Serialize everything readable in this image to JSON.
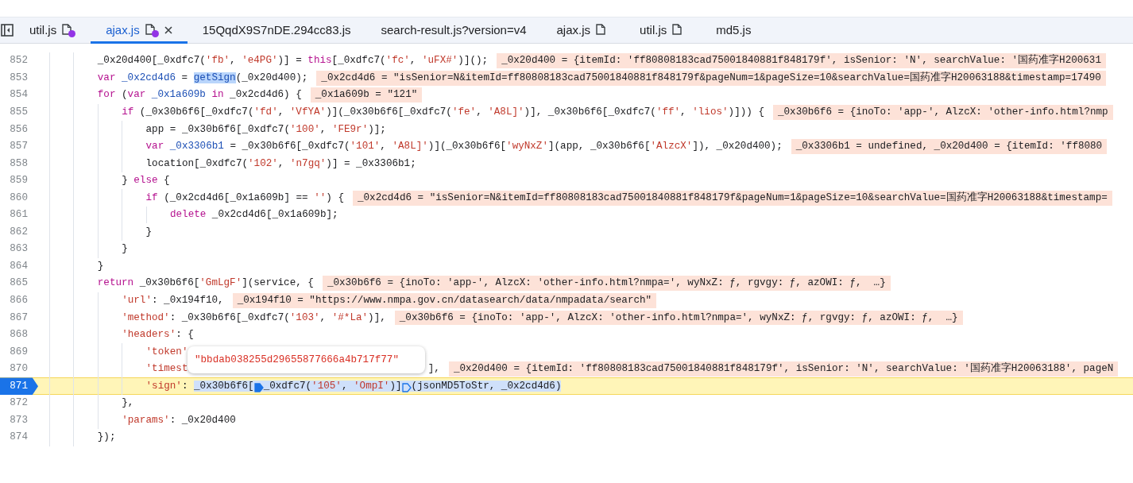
{
  "tabs": [
    {
      "label": "util.js",
      "selected": false,
      "file_icon": true,
      "dot": true,
      "closable": false
    },
    {
      "label": "ajax.js",
      "selected": true,
      "file_icon": true,
      "dot": true,
      "closable": true
    },
    {
      "label": "15QqdX9S7nDE.294cc83.js",
      "selected": false,
      "file_icon": false,
      "dot": false,
      "closable": false
    },
    {
      "label": "search-result.js?version=v4",
      "selected": false,
      "file_icon": false,
      "dot": false,
      "closable": false
    },
    {
      "label": "ajax.js",
      "selected": false,
      "file_icon": true,
      "dot": false,
      "closable": false
    },
    {
      "label": "util.js",
      "selected": false,
      "file_icon": true,
      "dot": false,
      "closable": false
    },
    {
      "label": "md5.js",
      "selected": false,
      "file_icon": false,
      "dot": false,
      "closable": false
    }
  ],
  "lines": [
    {
      "number": "852",
      "paused": false,
      "tokens": [
        {
          "kind": "plain",
          "text": "        _0x20d400[_0xdfc7("
        },
        {
          "kind": "string",
          "text": "'fb'"
        },
        {
          "kind": "plain",
          "text": ", "
        },
        {
          "kind": "string",
          "text": "'e4PG'"
        },
        {
          "kind": "plain",
          "text": ")] = "
        },
        {
          "kind": "keyword",
          "text": "this"
        },
        {
          "kind": "plain",
          "text": "[_0xdfc7("
        },
        {
          "kind": "string",
          "text": "'fc'"
        },
        {
          "kind": "plain",
          "text": ", "
        },
        {
          "kind": "string",
          "text": "'uFX#'"
        },
        {
          "kind": "plain",
          "text": ")]();"
        }
      ],
      "inline_value": "_0x20d400 = {itemId: 'ff80808183cad75001840881f848179f', isSenior: 'N', searchValue: '国药准字H200631"
    },
    {
      "number": "853",
      "paused": false,
      "tokens": [
        {
          "kind": "keyword",
          "text": "        var"
        },
        {
          "kind": "def",
          "text": " _0x2cd4d6"
        },
        {
          "kind": "plain",
          "text": " = "
        },
        {
          "kind": "match",
          "text": "getSign"
        },
        {
          "kind": "plain",
          "text": "(_0x20d400);"
        }
      ],
      "inline_value": "_0x2cd4d6 = \"isSenior=N&itemId=ff80808183cad75001840881f848179f&pageNum=1&pageSize=10&searchValue=国药准字H20063188&timestamp=17490"
    },
    {
      "number": "854",
      "paused": false,
      "tokens": [
        {
          "kind": "keyword",
          "text": "        for"
        },
        {
          "kind": "plain",
          "text": " ("
        },
        {
          "kind": "keyword",
          "text": "var"
        },
        {
          "kind": "def",
          "text": " _0x1a609b"
        },
        {
          "kind": "keyword",
          "text": " in"
        },
        {
          "kind": "plain",
          "text": " _0x2cd4d6) {"
        }
      ],
      "inline_value": "_0x1a609b = \"121\""
    },
    {
      "number": "855",
      "paused": false,
      "tokens": [
        {
          "kind": "keyword",
          "text": "            if"
        },
        {
          "kind": "plain",
          "text": " (_0x30b6f6[_0xdfc7("
        },
        {
          "kind": "string",
          "text": "'fd'"
        },
        {
          "kind": "plain",
          "text": ", "
        },
        {
          "kind": "string",
          "text": "'VfYA'"
        },
        {
          "kind": "plain",
          "text": ")](_0x30b6f6[_0xdfc7("
        },
        {
          "kind": "string",
          "text": "'fe'"
        },
        {
          "kind": "plain",
          "text": ", "
        },
        {
          "kind": "string",
          "text": "'A8L]'"
        },
        {
          "kind": "plain",
          "text": ")], _0x30b6f6[_0xdfc7("
        },
        {
          "kind": "string",
          "text": "'ff'"
        },
        {
          "kind": "plain",
          "text": ", "
        },
        {
          "kind": "string",
          "text": "'lios'"
        },
        {
          "kind": "plain",
          "text": ")])) {"
        }
      ],
      "inline_value": "_0x30b6f6 = {inoTo: 'app-', AlzcX: 'other-info.html?nmp"
    },
    {
      "number": "856",
      "paused": false,
      "tokens": [
        {
          "kind": "plain",
          "text": "                app = _0x30b6f6[_0xdfc7("
        },
        {
          "kind": "string",
          "text": "'100'"
        },
        {
          "kind": "plain",
          "text": ", "
        },
        {
          "kind": "string",
          "text": "'FE9r'"
        },
        {
          "kind": "plain",
          "text": ")];"
        }
      ]
    },
    {
      "number": "857",
      "paused": false,
      "tokens": [
        {
          "kind": "keyword",
          "text": "                var"
        },
        {
          "kind": "def",
          "text": " _0x3306b1"
        },
        {
          "kind": "plain",
          "text": " = _0x30b6f6[_0xdfc7("
        },
        {
          "kind": "string",
          "text": "'101'"
        },
        {
          "kind": "plain",
          "text": ", "
        },
        {
          "kind": "string",
          "text": "'A8L]'"
        },
        {
          "kind": "plain",
          "text": ")](_0x30b6f6["
        },
        {
          "kind": "string",
          "text": "'wyNxZ'"
        },
        {
          "kind": "plain",
          "text": "](app, _0x30b6f6["
        },
        {
          "kind": "string",
          "text": "'AlzcX'"
        },
        {
          "kind": "plain",
          "text": "]), _0x20d400);"
        }
      ],
      "inline_value": "_0x3306b1 = undefined, _0x20d400 = {itemId: 'ff8080"
    },
    {
      "number": "858",
      "paused": false,
      "tokens": [
        {
          "kind": "plain",
          "text": "                location[_0xdfc7("
        },
        {
          "kind": "string",
          "text": "'102'"
        },
        {
          "kind": "plain",
          "text": ", "
        },
        {
          "kind": "string",
          "text": "'n7gq'"
        },
        {
          "kind": "plain",
          "text": ")] = _0x3306b1;"
        }
      ]
    },
    {
      "number": "859",
      "paused": false,
      "tokens": [
        {
          "kind": "plain",
          "text": "            } "
        },
        {
          "kind": "keyword",
          "text": "else"
        },
        {
          "kind": "plain",
          "text": " {"
        }
      ]
    },
    {
      "number": "860",
      "paused": false,
      "tokens": [
        {
          "kind": "keyword",
          "text": "                if"
        },
        {
          "kind": "plain",
          "text": " (_0x2cd4d6[_0x1a609b] == "
        },
        {
          "kind": "string",
          "text": "''"
        },
        {
          "kind": "plain",
          "text": ") {"
        }
      ],
      "inline_value": "_0x2cd4d6 = \"isSenior=N&itemId=ff80808183cad75001840881f848179f&pageNum=1&pageSize=10&searchValue=国药准字H20063188&timestamp="
    },
    {
      "number": "861",
      "paused": false,
      "tokens": [
        {
          "kind": "keyword",
          "text": "                    delete"
        },
        {
          "kind": "plain",
          "text": " _0x2cd4d6[_0x1a609b];"
        }
      ]
    },
    {
      "number": "862",
      "paused": false,
      "tokens": [
        {
          "kind": "plain",
          "text": "                }"
        }
      ]
    },
    {
      "number": "863",
      "paused": false,
      "tokens": [
        {
          "kind": "plain",
          "text": "            }"
        }
      ]
    },
    {
      "number": "864",
      "paused": false,
      "tokens": [
        {
          "kind": "plain",
          "text": "        }"
        }
      ]
    },
    {
      "number": "865",
      "paused": false,
      "tokens": [
        {
          "kind": "keyword",
          "text": "        return"
        },
        {
          "kind": "plain",
          "text": " _0x30b6f6["
        },
        {
          "kind": "string",
          "text": "'GmLgF'"
        },
        {
          "kind": "plain",
          "text": "](service, {"
        }
      ],
      "inline_value": "_0x30b6f6 = {inoTo: 'app-', AlzcX: 'other-info.html?nmpa=', wyNxZ: ƒ, rgvgy: ƒ, azOWI: ƒ,  …}"
    },
    {
      "number": "866",
      "paused": false,
      "tokens": [
        {
          "kind": "string",
          "text": "            'url'"
        },
        {
          "kind": "plain",
          "text": ": _0x194f10,"
        }
      ],
      "inline_value": "_0x194f10 = \"https://www.nmpa.gov.cn/datasearch/data/nmpadata/search\""
    },
    {
      "number": "867",
      "paused": false,
      "tokens": [
        {
          "kind": "string",
          "text": "            'method'"
        },
        {
          "kind": "plain",
          "text": ": _0x30b6f6[_0xdfc7("
        },
        {
          "kind": "string",
          "text": "'103'"
        },
        {
          "kind": "plain",
          "text": ", "
        },
        {
          "kind": "string",
          "text": "'#*La'"
        },
        {
          "kind": "plain",
          "text": ")],"
        }
      ],
      "inline_value": "_0x30b6f6 = {inoTo: 'app-', AlzcX: 'other-info.html?nmpa=', wyNxZ: ƒ, rgvgy: ƒ, azOWI: ƒ,  …}"
    },
    {
      "number": "868",
      "paused": false,
      "tokens": [
        {
          "kind": "string",
          "text": "            'headers'"
        },
        {
          "kind": "plain",
          "text": ": {"
        }
      ]
    },
    {
      "number": "869",
      "paused": false,
      "tokens": [
        {
          "kind": "string",
          "text": "                'token'"
        }
      ],
      "popover": "\"bbdab038255d29655877666a4b717f77\""
    },
    {
      "number": "870",
      "paused": false,
      "tokens": [
        {
          "kind": "string",
          "text": "                'timest"
        },
        {
          "kind": "plain",
          "text": "                                        ],"
        }
      ],
      "inline_value": "_0x20d400 = {itemId: 'ff80808183cad75001840881f848179f', isSenior: 'N', searchValue: '国药准字H20063188', pageN"
    },
    {
      "number": "871",
      "paused": true,
      "tokens": [
        {
          "kind": "string",
          "text": "                'sign'"
        },
        {
          "kind": "plain",
          "text": ": "
        },
        {
          "kind": "sel",
          "text": "_0x30b6f6["
        },
        {
          "kind": "marker-filled"
        },
        {
          "kind": "sel",
          "text": "_0xdfc7("
        },
        {
          "kind": "sel-string",
          "text": "'105'"
        },
        {
          "kind": "sel",
          "text": ", "
        },
        {
          "kind": "sel-string",
          "text": "'OmpI'"
        },
        {
          "kind": "sel",
          "text": ")]"
        },
        {
          "kind": "marker-outline"
        },
        {
          "kind": "sel",
          "text": "(jsonMD5ToStr, _0x2cd4d6)"
        }
      ]
    },
    {
      "number": "872",
      "paused": false,
      "tokens": [
        {
          "kind": "plain",
          "text": "            },"
        }
      ]
    },
    {
      "number": "873",
      "paused": false,
      "tokens": [
        {
          "kind": "string",
          "text": "            'params'"
        },
        {
          "kind": "plain",
          "text": ": _0x20d400"
        }
      ]
    },
    {
      "number": "874",
      "paused": false,
      "tokens": [
        {
          "kind": "plain",
          "text": "        });"
        }
      ]
    }
  ]
}
